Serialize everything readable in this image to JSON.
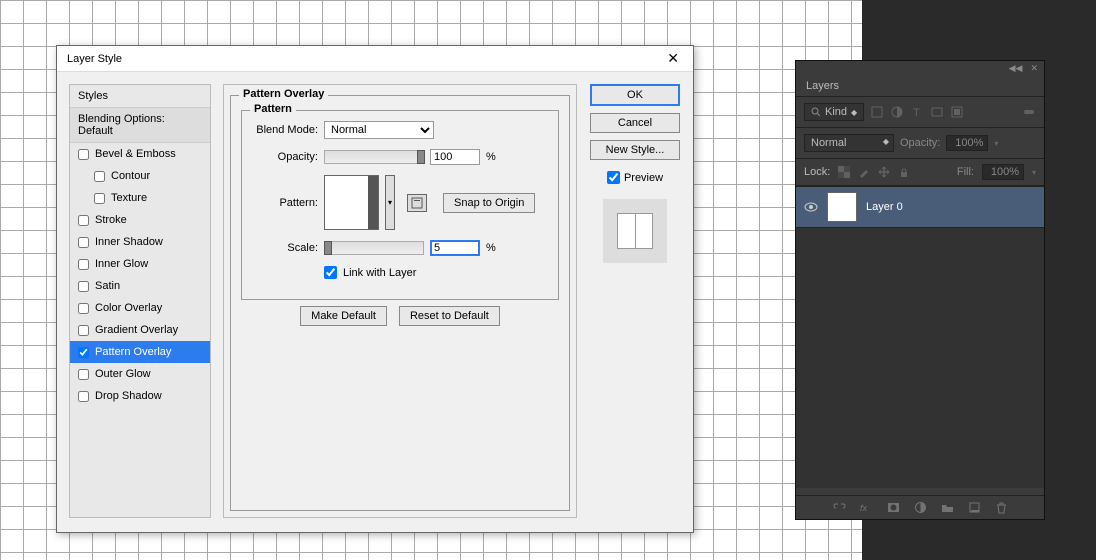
{
  "dialog": {
    "title": "Layer Style",
    "styles_header": "Styles",
    "blending": "Blending Options: Default",
    "items": [
      {
        "label": "Bevel & Emboss",
        "checked": false,
        "indent": false
      },
      {
        "label": "Contour",
        "checked": false,
        "indent": true
      },
      {
        "label": "Texture",
        "checked": false,
        "indent": true
      },
      {
        "label": "Stroke",
        "checked": false,
        "indent": false
      },
      {
        "label": "Inner Shadow",
        "checked": false,
        "indent": false
      },
      {
        "label": "Inner Glow",
        "checked": false,
        "indent": false
      },
      {
        "label": "Satin",
        "checked": false,
        "indent": false
      },
      {
        "label": "Color Overlay",
        "checked": false,
        "indent": false
      },
      {
        "label": "Gradient Overlay",
        "checked": false,
        "indent": false
      },
      {
        "label": "Pattern Overlay",
        "checked": true,
        "indent": false,
        "selected": true
      },
      {
        "label": "Outer Glow",
        "checked": false,
        "indent": false
      },
      {
        "label": "Drop Shadow",
        "checked": false,
        "indent": false
      }
    ]
  },
  "overlay": {
    "group_label": "Pattern Overlay",
    "inner_label": "Pattern",
    "blend_label": "Blend Mode:",
    "blend_value": "Normal",
    "opacity_label": "Opacity:",
    "opacity_value": "100",
    "opacity_unit": "%",
    "pattern_label": "Pattern:",
    "snap_btn": "Snap to Origin",
    "scale_label": "Scale:",
    "scale_value": "5",
    "scale_unit": "%",
    "link_label": "Link with Layer",
    "make_default": "Make Default",
    "reset_default": "Reset to Default"
  },
  "buttons": {
    "ok": "OK",
    "cancel": "Cancel",
    "new_style": "New Style...",
    "preview": "Preview"
  },
  "layers": {
    "tab": "Layers",
    "kind": "Kind",
    "blend": "Normal",
    "opacity_label": "Opacity:",
    "opacity_val": "100%",
    "lock_label": "Lock:",
    "fill_label": "Fill:",
    "fill_val": "100%",
    "layer_name": "Layer 0"
  }
}
